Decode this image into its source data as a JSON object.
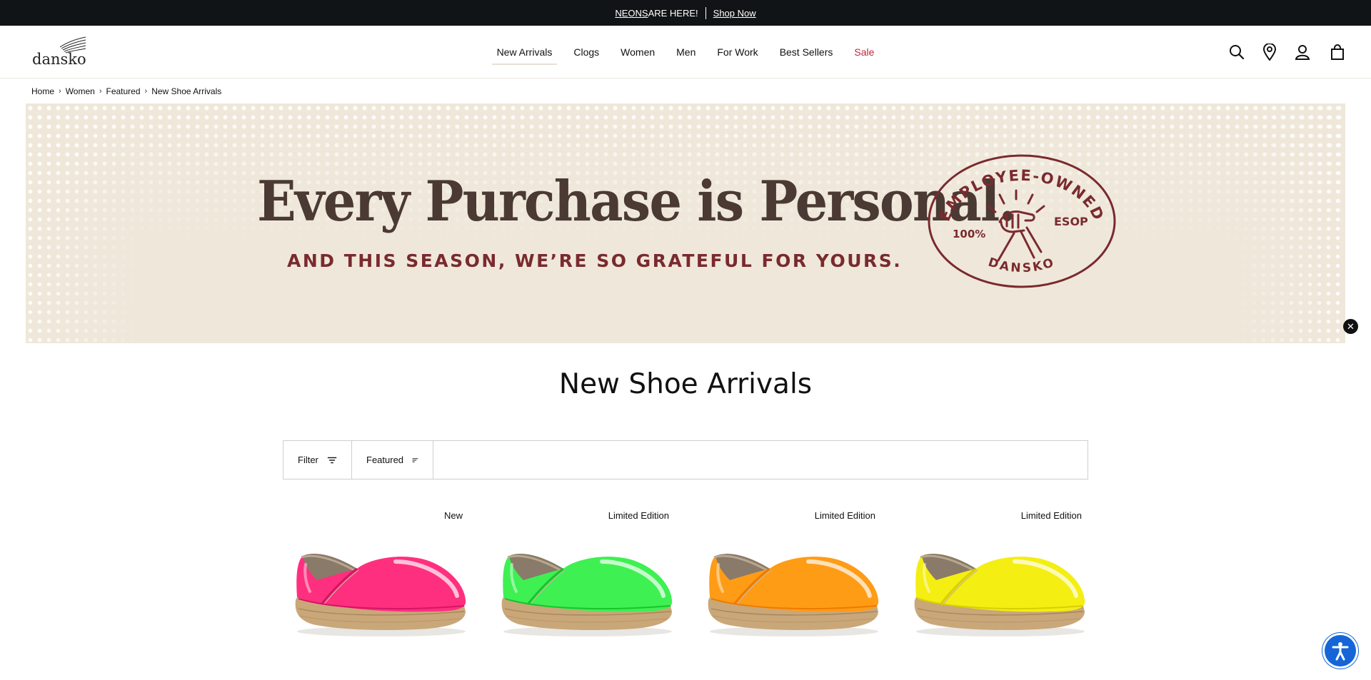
{
  "promo": {
    "highlight": "NEONS",
    "text": " ARE HERE!",
    "link": "Shop Now"
  },
  "header": {
    "logo_text": "dansko",
    "nav": [
      {
        "label": "New Arrivals"
      },
      {
        "label": "Clogs"
      },
      {
        "label": "Women"
      },
      {
        "label": "Men"
      },
      {
        "label": "For Work"
      },
      {
        "label": "Best Sellers"
      },
      {
        "label": "Sale"
      }
    ],
    "icons": [
      "search-icon",
      "store-locator-icon",
      "account-icon",
      "cart-icon"
    ]
  },
  "breadcrumb": [
    "Home",
    "Women",
    "Featured",
    "New Shoe Arrivals"
  ],
  "hero": {
    "headline": "Every Purchase is Personal.",
    "subhead": "AND THIS SEASON, WE’RE SO GRATEFUL FOR YOURS.",
    "seal": {
      "top": "EMPLOYEE-OWNED",
      "left": "100%",
      "right": "ESOP",
      "bottom": "DANSKO"
    }
  },
  "page_title": "New Shoe Arrivals",
  "toolbar": {
    "filter_label": "Filter",
    "sort_label": "Featured"
  },
  "products": [
    {
      "badge": "New",
      "color": "#ff2f7f",
      "color_dark": "#d41565"
    },
    {
      "badge": "Limited Edition",
      "color": "#3ef052",
      "color_dark": "#16c52c"
    },
    {
      "badge": "Limited Edition",
      "color": "#ff9c16",
      "color_dark": "#ee7a00"
    },
    {
      "badge": "Limited Edition",
      "color": "#f4ee12",
      "color_dark": "#d9cf00"
    }
  ],
  "colors": {
    "promo_bg": "#111416",
    "sale": "#c4233b",
    "hero_bg": "#efe8da",
    "headline": "#4a3a33",
    "subhead": "#7a2a2f",
    "a11y": "#1565d8"
  }
}
